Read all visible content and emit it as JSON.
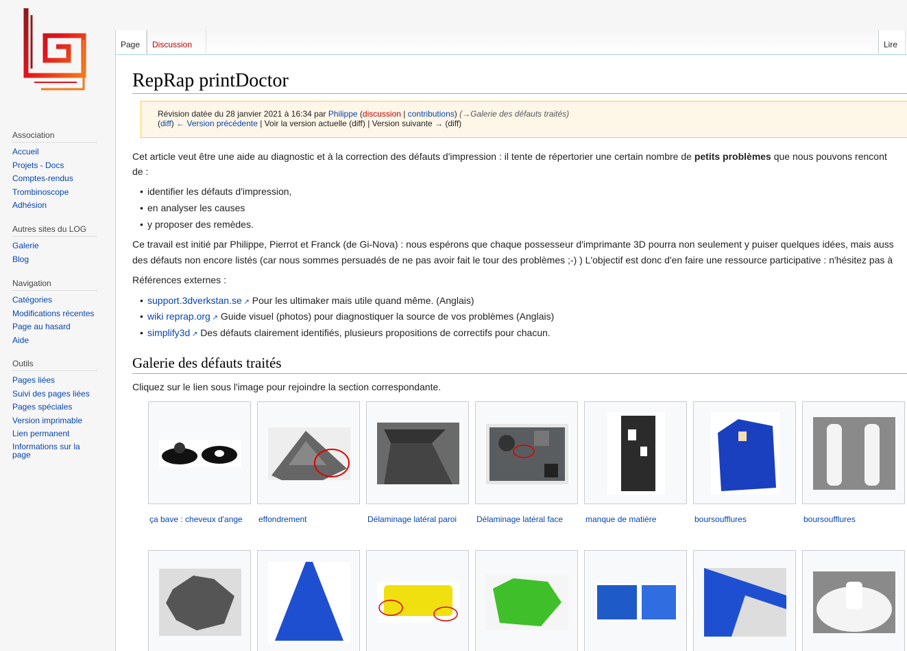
{
  "sidebar": {
    "sections": [
      {
        "title": "Association",
        "items": [
          "Accueil",
          "Projets - Docs",
          "Comptes-rendus",
          "Trombinoscope",
          "Adhésion"
        ]
      },
      {
        "title": "Autres sites du LOG",
        "items": [
          "Galerie",
          "Blog"
        ]
      },
      {
        "title": "Navigation",
        "items": [
          "Catégories",
          "Modifications récentes",
          "Page au hasard",
          "Aide"
        ]
      },
      {
        "title": "Outils",
        "items": [
          "Pages liées",
          "Suivi des pages liées",
          "Pages spéciales",
          "Version imprimable",
          "Lien permanent",
          "Informations sur la page"
        ]
      }
    ]
  },
  "tabs": {
    "page": "Page",
    "discussion": "Discussion",
    "read": "Lire"
  },
  "title": "RepRap printDoctor",
  "revision": {
    "prefix": "Révision datée du 28 janvier 2021 à 16:34 par ",
    "user": "Philippe",
    "open": " (",
    "talk": "discussion",
    "sep": " | ",
    "contribs": "contributions",
    "close": ") ",
    "comment": "(→Galerie des défauts traités)",
    "l2_diff": "diff",
    "l2_prev": "← Version précédente",
    "l2_rest": " | Voir la version actuelle (diff) | Version suivante → (diff)"
  },
  "intro": {
    "p1a": "Cet article veut être une aide au diagnostic et à la correction des défauts d'impression : il tente de répertorier une certain nombre de ",
    "p1b": "petits problèmes",
    "p1c": " que nous pouvons rencont",
    "p1d": "de :",
    "bullets": [
      "identifier les défauts d'impression,",
      "en analyser les causes",
      "y proposer des remèdes."
    ],
    "p2a": "Ce travail est initié par Philippe, Pierrot et Franck (de Gi-Nova) : nous espérons que chaque possesseur d'imprimante 3D pourra non seulement y puiser quelques idées, mais auss",
    "p2b": "des défauts non encore listés (car nous sommes persuadés de ne pas avoir fait le tour des problèmes ;-) ) L'objectif est donc d'en faire une ressource participative : n'hésitez pas à",
    "refs": "Références externes :",
    "links": [
      {
        "link": "support.3dverkstan.se",
        "text": " Pour les ultimaker mais utile quand même. (Anglais)"
      },
      {
        "link": "wiki reprap.org",
        "text": " Guide visuel (photos) pour diagnostiquer la source de vos problèmes (Anglais)"
      },
      {
        "link": "simplify3d",
        "text": " Des défauts clairement identifiés, plusieurs propositions de correctifs pour chacun."
      }
    ]
  },
  "gallery": {
    "heading": "Galerie des défauts traités",
    "intro": "Cliquez sur le lien sous l'image pour rejoindre la section correspondante.",
    "captions": [
      "ça bave : cheveux d'ange",
      "effondrement",
      "Délaminage latéral paroi",
      "Délaminage latéral face",
      "manque de matière",
      "boursoufflures",
      "boursoufflures"
    ]
  },
  "colors": {
    "link": "#0645ad",
    "red_link": "#ba0000",
    "revbox_bg": "#fef6e7"
  }
}
